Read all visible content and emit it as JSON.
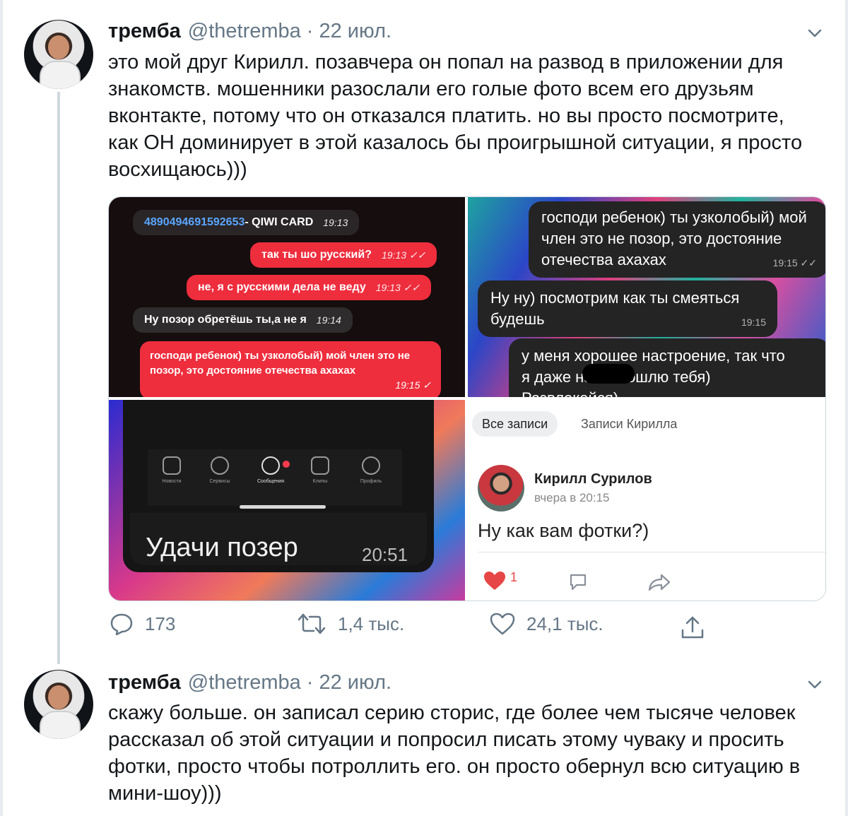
{
  "tweet1": {
    "author_name": "тремба",
    "author_handle": "@thetremba",
    "separator": "·",
    "date": "22 июл.",
    "text": "это мой друг Кирилл. позавчера он попал на развод в приложении для знакомств. мошенники разослали его голые фото всем его друзьям вконтакте, потому что он отказался платить. но вы просто посмотрите, как ОН доминирует в этой казалось бы проигрышной ситуации, я просто восхищаюсь)))",
    "media": {
      "chat1": {
        "qiwi_number": "4890494691592653",
        "qiwi_suffix": " - QIWI CARD",
        "qiwi_time": "19:13",
        "msg1": "так ты шо русский?",
        "msg1_time": "19:13 ✓✓",
        "msg2": "не, я с русскими дела не веду",
        "msg2_time": "19:13 ✓✓",
        "msg3": "Ну позор обретёшь ты,а не я",
        "msg3_time": "19:14",
        "msg4": "господи ребенок) ты узколобый) мой член это не позор, это достояние отечества ахахах",
        "msg4_time": "19:15 ✓"
      },
      "chat2": {
        "msg1": "господи ребенок) ты узколобый) мой член это не позор, это достояние отечества ахахах",
        "msg1_time": "19:15 ✓✓",
        "msg2": "Ну ну) посмотрим как ты смеяться будешь",
        "msg2_time": "19:15",
        "msg3a": "у меня хорошее настроение, так что",
        "msg3b": "я даже на      не пошлю тебя)",
        "msg3c": "Развлекайся)"
      },
      "chat3": {
        "nav_items": [
          "Новости",
          "Сервисы",
          "Сообщения",
          "Клипы",
          "Профиль"
        ],
        "message": "Удачи позер",
        "time": "20:51"
      },
      "vk": {
        "tab_all": "Все записи",
        "tab_user": "Записи Кирилла",
        "author": "Кирилл Сурилов",
        "time": "вчера в 20:15",
        "post": "Ну как вам фотки?)",
        "likes": "1"
      }
    },
    "actions": {
      "replies": "173",
      "retweets": "1,4 тыс.",
      "likes": "24,1 тыс."
    }
  },
  "tweet2": {
    "author_name": "тремба",
    "author_handle": "@thetremba",
    "separator": "·",
    "date": "22 июл.",
    "text": "скажу больше. он записал серию сторис, где более чем тысяче человек рассказал об этой ситуации и попросил писать этому чуваку и просить фотки, просто чтобы потроллить его. он просто обернул всю ситуацию в мини-шоу)))"
  },
  "colors": {
    "accent_gray": "#657786",
    "vk_red": "#e64646",
    "chat_red": "#ee2d3d"
  }
}
